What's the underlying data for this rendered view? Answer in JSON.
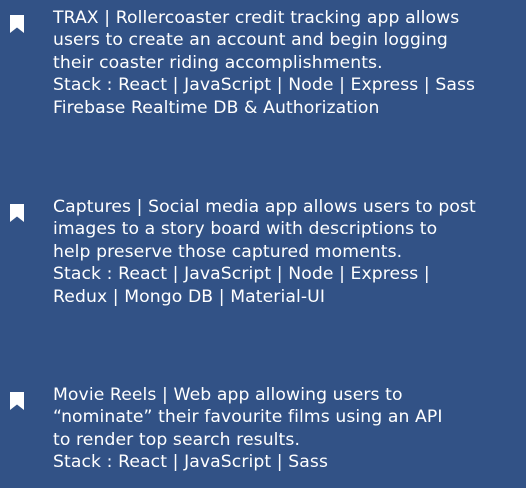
{
  "projects": [
    {
      "lines": [
        "TRAX | Rollercoaster credit tracking app allows",
        "users to create an account and begin logging",
        "their coaster riding accomplishments.",
        "Stack : React | JavaScript | Node | Express | Sass",
        "Firebase Realtime DB & Authorization"
      ]
    },
    {
      "lines": [
        "Captures | Social media app allows users to post",
        "images to a story board with descriptions to",
        "help preserve those captured moments.",
        "Stack : React | JavaScript | Node | Express |",
        "Redux | Mongo DB | Material-UI"
      ]
    },
    {
      "lines": [
        "Movie Reels | Web app allowing users to",
        "“nominate” their favourite films using an API",
        "to render top search results.",
        "Stack : React | JavaScript | Sass"
      ]
    }
  ],
  "icons": {
    "bullet": "bookmark-icon"
  },
  "colors": {
    "background": "#325286",
    "text": "#ffffff"
  }
}
